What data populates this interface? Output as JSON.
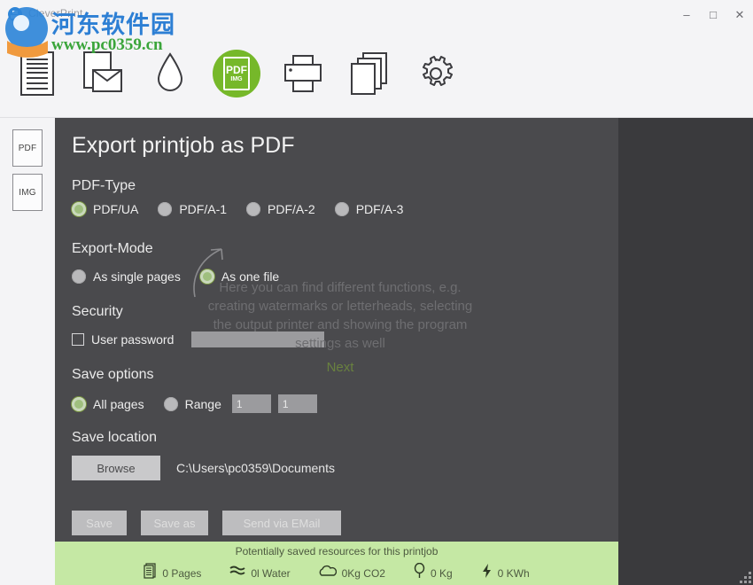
{
  "window": {
    "title": "CleverPrint",
    "app_icon": "printer-app-icon",
    "controls": {
      "minimize": "–",
      "maximize": "□",
      "close": "✕"
    }
  },
  "watermark": {
    "chinese": "河东软件园",
    "url": "www.pc0359.cn"
  },
  "toolbar": {
    "items": [
      {
        "name": "document-icon",
        "label": "Document"
      },
      {
        "name": "mail-document-icon",
        "label": "Send as mail"
      },
      {
        "name": "water-drop-icon",
        "label": "Watermark"
      },
      {
        "name": "pdf-img-icon",
        "label": "PDF",
        "sub_label": "IMG",
        "active": true
      },
      {
        "name": "printer-icon",
        "label": "Printer"
      },
      {
        "name": "copy-pages-icon",
        "label": "Copies"
      },
      {
        "name": "gear-icon",
        "label": "Settings"
      }
    ],
    "accent_color": "#76b82a"
  },
  "sidebar": {
    "items": [
      {
        "name": "sidebar-item-pdf",
        "label": "PDF"
      },
      {
        "name": "sidebar-item-img",
        "label": "IMG"
      }
    ]
  },
  "main": {
    "page_title": "Export printjob as PDF",
    "pdf_type": {
      "label": "PDF-Type",
      "options": [
        {
          "label": "PDF/UA",
          "selected": true
        },
        {
          "label": "PDF/A-1",
          "selected": false
        },
        {
          "label": "PDF/A-2",
          "selected": false
        },
        {
          "label": "PDF/A-3",
          "selected": false
        }
      ]
    },
    "export_mode": {
      "label": "Export-Mode",
      "options": [
        {
          "label": "As single pages",
          "selected": false
        },
        {
          "label": "As one file",
          "selected": true
        }
      ]
    },
    "security": {
      "label": "Security",
      "checkbox_label": "User password",
      "checked": false,
      "password_value": "",
      "password_placeholder": ""
    },
    "save_options": {
      "label": "Save options",
      "options": [
        {
          "label": "All pages",
          "selected": true
        },
        {
          "label": "Range",
          "selected": false
        }
      ],
      "range_from": "1",
      "range_to": "1"
    },
    "save_location": {
      "label": "Save location",
      "browse_label": "Browse",
      "path": "C:\\Users\\pc0359\\Documents"
    },
    "actions": [
      {
        "label": "Save",
        "disabled": true
      },
      {
        "label": "Save as",
        "disabled": true
      },
      {
        "label": "Send via EMail",
        "disabled": true
      }
    ]
  },
  "coachmark": {
    "text": "Here you can find different functions, e.g. creating watermarks or letterheads, selecting the output printer and showing the program settings as well",
    "next_label": "Next",
    "next_color": "#69813f"
  },
  "statusbar": {
    "title": "Potentially saved resources for this printjob",
    "background": "#c5e8a4",
    "items": [
      {
        "icon": "pages-icon",
        "value": "0 Pages"
      },
      {
        "icon": "water-waves-icon",
        "value": "0l  Water"
      },
      {
        "icon": "cloud-icon",
        "value": "0Kg  CO2"
      },
      {
        "icon": "tree-icon",
        "value": "0 Kg"
      },
      {
        "icon": "lightning-icon",
        "value": "0 KWh"
      }
    ]
  }
}
